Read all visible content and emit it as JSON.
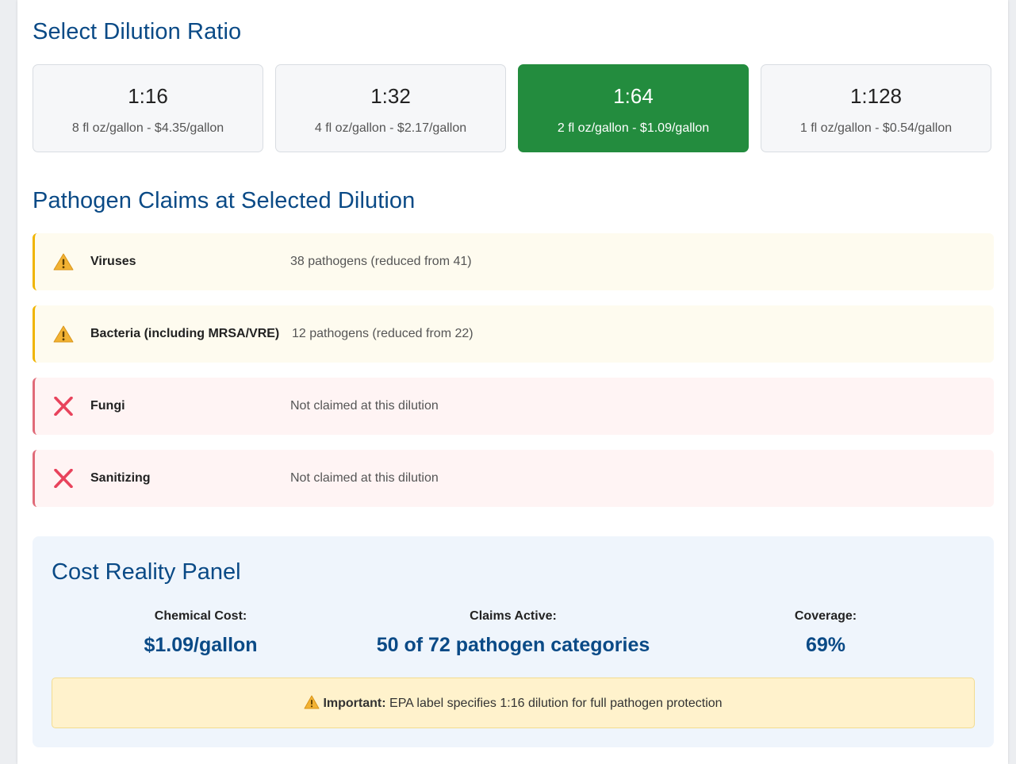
{
  "dilution": {
    "title": "Select Dilution Ratio",
    "options": [
      {
        "ratio": "1:16",
        "detail": "8 fl oz/gallon - $4.35/gallon",
        "selected": false
      },
      {
        "ratio": "1:32",
        "detail": "4 fl oz/gallon - $2.17/gallon",
        "selected": false
      },
      {
        "ratio": "1:64",
        "detail": "2 fl oz/gallon - $1.09/gallon",
        "selected": true
      },
      {
        "ratio": "1:128",
        "detail": "1 fl oz/gallon - $0.54/gallon",
        "selected": false
      }
    ]
  },
  "claims": {
    "title": "Pathogen Claims at Selected Dilution",
    "items": [
      {
        "category": "Viruses",
        "status": "38 pathogens (reduced from 41)",
        "level": "warning",
        "icon": "warning-icon"
      },
      {
        "category": "Bacteria (including MRSA/VRE)",
        "status": "12 pathogens (reduced from 22)",
        "level": "warning",
        "icon": "warning-icon"
      },
      {
        "category": "Fungi",
        "status": "Not claimed at this dilution",
        "level": "not-claimed",
        "icon": "cross-icon"
      },
      {
        "category": "Sanitizing",
        "status": "Not claimed at this dilution",
        "level": "not-claimed",
        "icon": "cross-icon"
      }
    ]
  },
  "cost_panel": {
    "title": "Cost Reality Panel",
    "metrics": [
      {
        "label": "Chemical Cost:",
        "value": "$1.09/gallon"
      },
      {
        "label": "Claims Active:",
        "value": "50 of 72 pathogen categories"
      },
      {
        "label": "Coverage:",
        "value": "69%"
      }
    ],
    "notice": {
      "strong": "Important:",
      "text": "EPA label specifies 1:16 dilution for full pathogen protection"
    }
  },
  "colors": {
    "heading": "#0a4a86",
    "selected_green": "#238c3e",
    "warning_border": "#f0b400",
    "warning_bg": "#fefbef",
    "fail_border": "#e06a78",
    "fail_bg": "#fff4f4",
    "panel_bg": "#eff5fc",
    "notice_bg": "#fff2cc"
  }
}
